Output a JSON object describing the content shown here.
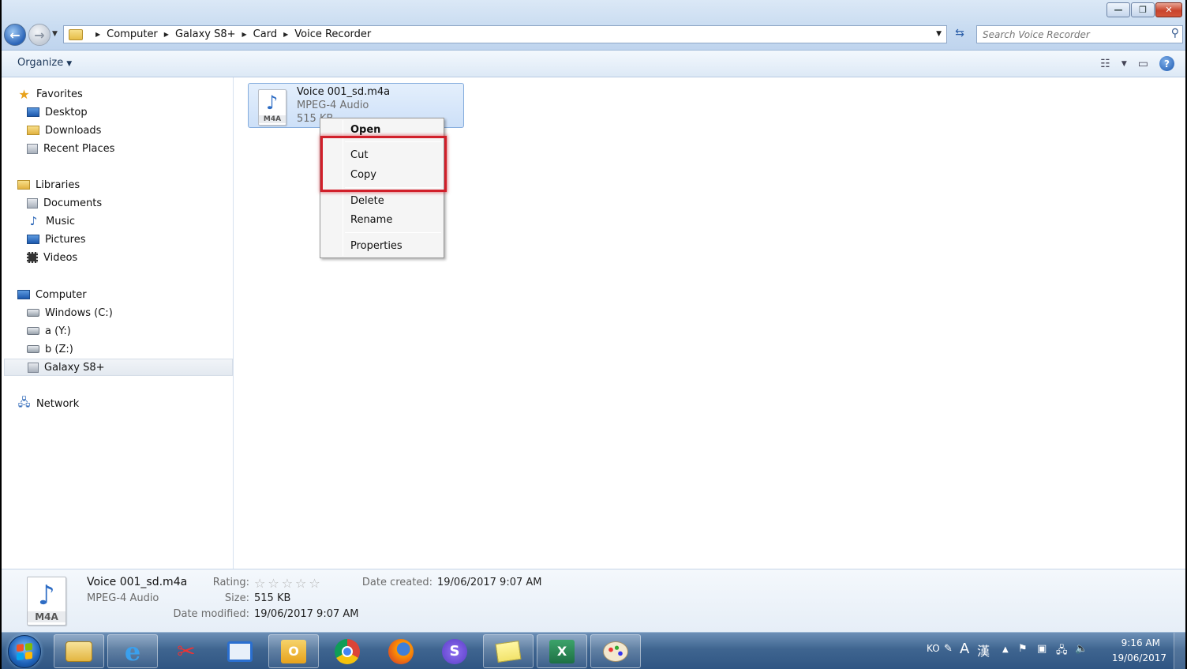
{
  "window": {
    "minimize_label": "—",
    "restore_label": "❐",
    "close_label": "✕"
  },
  "address": {
    "breadcrumb": [
      "Computer",
      "Galaxy S8+",
      "Card",
      "Voice Recorder"
    ]
  },
  "search": {
    "placeholder": "Search Voice Recorder"
  },
  "toolbar": {
    "organize_label": "Organize",
    "help_label": "?"
  },
  "sidebar": {
    "favorites": {
      "label": "Favorites",
      "items": [
        "Desktop",
        "Downloads",
        "Recent Places"
      ]
    },
    "libraries": {
      "label": "Libraries",
      "items": [
        "Documents",
        "Music",
        "Pictures",
        "Videos"
      ]
    },
    "computer": {
      "label": "Computer",
      "items": [
        "Windows (C:)",
        "a (Y:)",
        "b (Z:)",
        "Galaxy S8+"
      ]
    },
    "network": {
      "label": "Network"
    },
    "selected": "Galaxy S8+"
  },
  "file": {
    "name": "Voice 001_sd.m4a",
    "type": "MPEG-4 Audio",
    "size": "515 KB",
    "icon_label": "M4A"
  },
  "context_menu": {
    "open": "Open",
    "cut": "Cut",
    "copy": "Copy",
    "delete": "Delete",
    "rename": "Rename",
    "properties": "Properties"
  },
  "details": {
    "name": "Voice 001_sd.m4a",
    "type": "MPEG-4 Audio",
    "rating_label": "Rating:",
    "rating": 0,
    "size_label": "Size:",
    "size": "515 KB",
    "date_modified_label": "Date modified:",
    "date_modified": "19/06/2017 9:07 AM",
    "date_created_label": "Date created:",
    "date_created": "19/06/2017 9:07 AM"
  },
  "taskbar": {
    "ime_lang": "KO",
    "ime_a": "A",
    "ime_han": "漢",
    "time": "9:16 AM",
    "date": "19/06/2017"
  },
  "colors": {
    "highlight": "#d11f2a",
    "selection": "#cde0f8",
    "taskbar": "#3f6590"
  }
}
